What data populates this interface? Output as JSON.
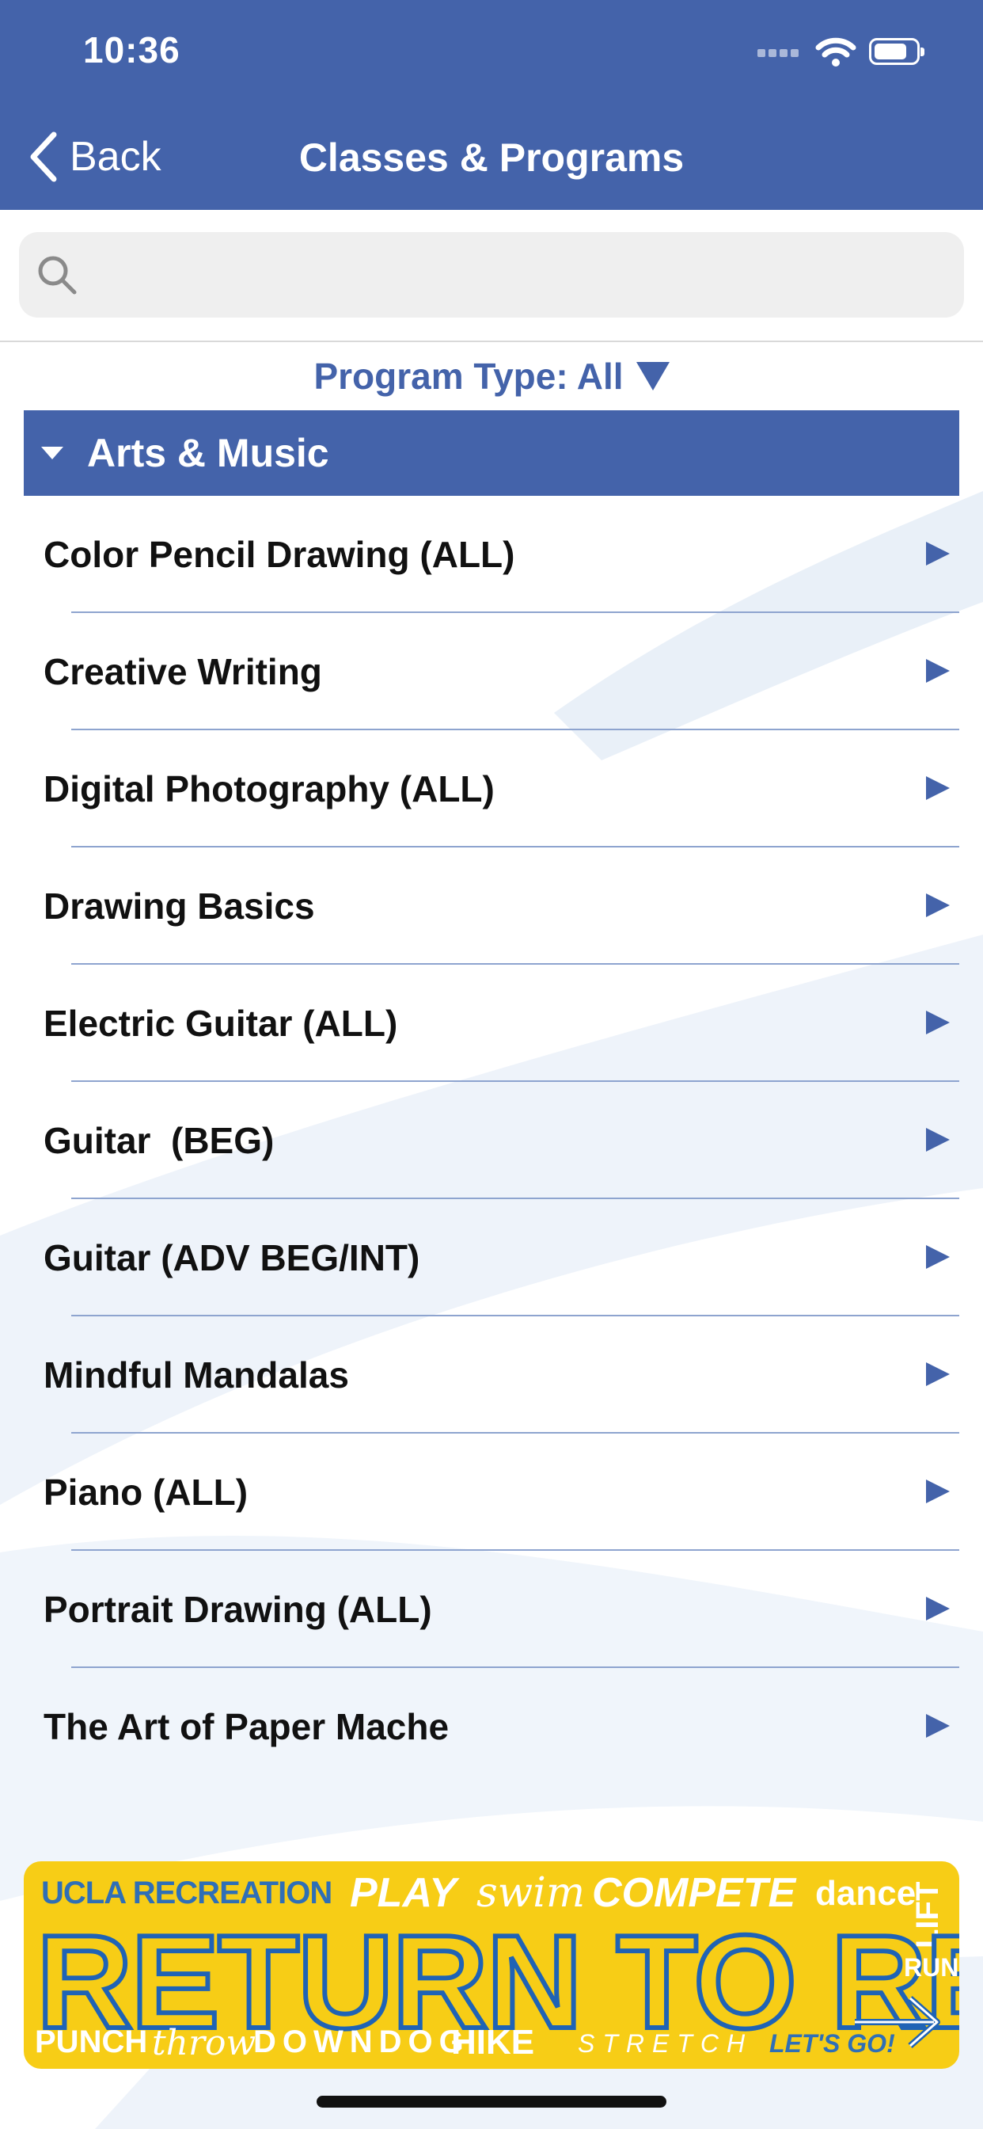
{
  "status_bar": {
    "time": "10:36"
  },
  "nav": {
    "back_label": "Back",
    "title": "Classes & Programs"
  },
  "search": {
    "placeholder": "",
    "value": ""
  },
  "filter": {
    "label": "Program Type: All"
  },
  "section": {
    "title": "Arts & Music"
  },
  "items": [
    {
      "label": "Color Pencil Drawing (ALL)"
    },
    {
      "label": "Creative Writing"
    },
    {
      "label": "Digital Photography (ALL)"
    },
    {
      "label": "Drawing Basics"
    },
    {
      "label": "Electric Guitar (ALL)"
    },
    {
      "label": "Guitar  (BEG)"
    },
    {
      "label": "Guitar (ADV BEG/INT)"
    },
    {
      "label": "Mindful Mandalas"
    },
    {
      "label": "Piano (ALL)"
    },
    {
      "label": "Portrait Drawing (ALL)"
    },
    {
      "label": "The Art of Paper Mache"
    }
  ],
  "banner": {
    "top_left": "UCLA RECREATION",
    "play": "PLAY",
    "swim": "swim",
    "compete": "COMPETE",
    "dance": "dance",
    "lift": "LIFT",
    "headline": "RETURN TO REC",
    "run": "RUN",
    "punch": "PUNCH",
    "throw": "throw",
    "downdog": "DOWNDOG",
    "hike": "HIKE",
    "stretch": "STRETCH",
    "lets_go": "LET'S GO!"
  },
  "colors": {
    "brand": "#4463aa",
    "banner_yellow": "#f7cd16",
    "banner_blue": "#1f63b5"
  }
}
